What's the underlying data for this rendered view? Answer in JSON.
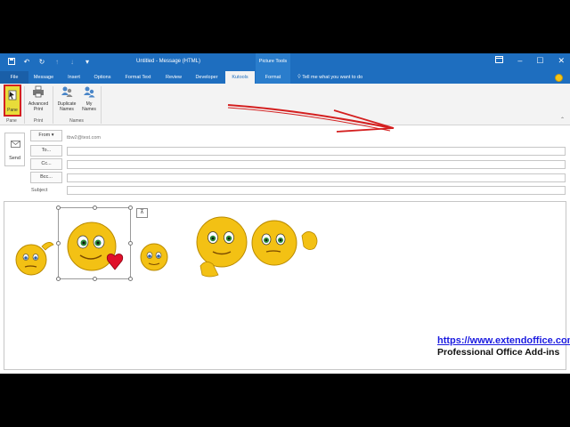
{
  "window": {
    "title": "Untitled  -  Message (HTML)",
    "context_tools_label": "Picture Tools"
  },
  "qat": {
    "save_icon": "save-icon",
    "undo_icon": "undo-icon",
    "redo_icon": "redo-icon",
    "up_icon": "up-arrow-icon",
    "down_icon": "down-arrow-icon",
    "customize_icon": "customize-qat-icon"
  },
  "tabs": [
    {
      "label": "File"
    },
    {
      "label": "Message"
    },
    {
      "label": "Insert"
    },
    {
      "label": "Options"
    },
    {
      "label": "Format Text"
    },
    {
      "label": "Review"
    },
    {
      "label": "Developer"
    },
    {
      "label": "Kutools"
    },
    {
      "label": "Format"
    }
  ],
  "tell_me": "Tell me what you want to do",
  "ribbon": {
    "pane_label": "Pane",
    "advanced_print": "Advanced Print",
    "duplicate_names": "Duplicate Names",
    "my_names": "My Names",
    "groups": {
      "pane": "Pane",
      "print": "Print",
      "names": "Names"
    }
  },
  "compose": {
    "send_label": "Send",
    "from_label": "From",
    "from_address": "tbw2@test.com",
    "to_label": "To...",
    "cc_label": "Cc...",
    "bcc_label": "Bcc...",
    "subject_label": "Subject"
  },
  "branding": {
    "url": "https://www.extendoffice.com",
    "tagline": "Professional Office Add-ins"
  },
  "colors": {
    "titlebar": "#1e6ebf",
    "ribbon": "#f3f3f3",
    "highlight": "#e8dc3a",
    "annotation_arrow": "#d42020",
    "link": "#1a1ae0"
  }
}
